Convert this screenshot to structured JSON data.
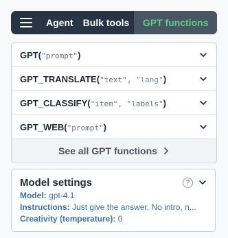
{
  "nav": {
    "tabs": [
      {
        "label": "Agent"
      },
      {
        "label": "Bulk tools"
      },
      {
        "label": "GPT functions"
      }
    ],
    "active_tab": "GPT functions"
  },
  "functions": [
    {
      "name": "GPT",
      "args": [
        "\"prompt\""
      ]
    },
    {
      "name": "GPT_TRANSLATE",
      "args": [
        "\"text\"",
        "\"lang\""
      ]
    },
    {
      "name": "GPT_CLASSIFY",
      "args": [
        "\"item\"",
        "\"labels\""
      ]
    },
    {
      "name": "GPT_WEB",
      "args": [
        "\"prompt\""
      ]
    }
  ],
  "see_all_label": "See all GPT functions",
  "model_settings": {
    "title": "Model settings",
    "model_label": "Model:",
    "model_value": "gpt-4.1",
    "instructions_label": "Instructions:",
    "instructions_value": "Just give the answer. No intro, n...",
    "creativity_label": "Creativity (temperature):",
    "creativity_value": "0"
  },
  "colors": {
    "nav_bg": "#283443",
    "active_tab_bg": "#4a5564",
    "active_tab_text": "#59d08a",
    "link_blue": "#3b6fb6"
  },
  "icons": {
    "menu": "hamburger-icon",
    "expand": "chevron-down-icon",
    "see_all": "chevron-right-icon",
    "help": "question-circle-icon"
  }
}
